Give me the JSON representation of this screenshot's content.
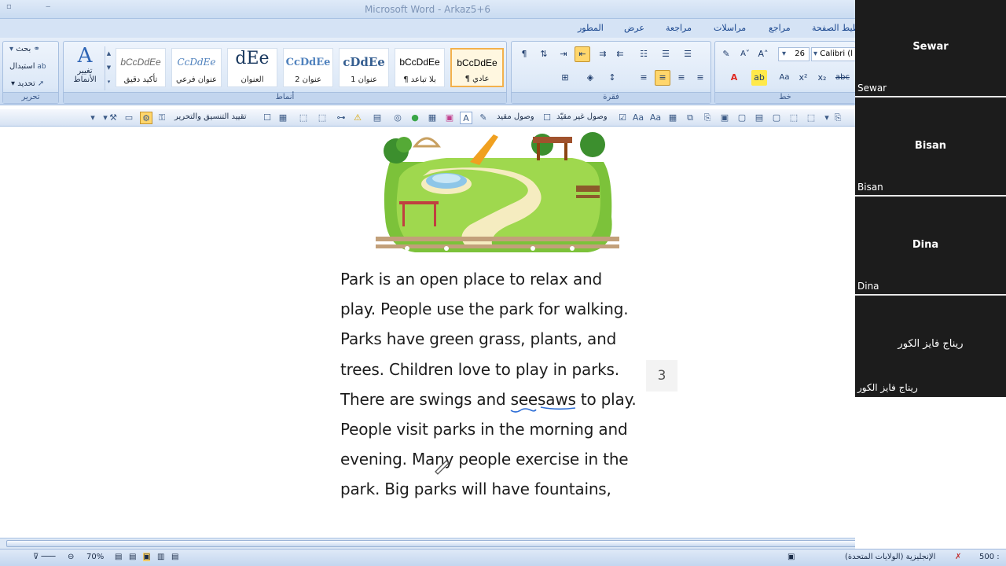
{
  "window": {
    "title": "Microsoft Word - Arkaz5+6"
  },
  "ribbon_tabs": [
    "المطور",
    "عرض",
    "مراجعة",
    "مراسلات",
    "مراجع",
    "تخطيط الصفحة"
  ],
  "editing_group": {
    "label": "تحرير",
    "find": "بحث",
    "replace": "استبدال",
    "select": "تحديد"
  },
  "change_styles": {
    "label_line1": "تغيير",
    "label_line2": "الأنماط"
  },
  "styles_group": {
    "label": "أنماط",
    "styles": [
      {
        "sample": "bCcDdEe",
        "name": "تأكيد دقيق"
      },
      {
        "sample": "CcDdEe",
        "name": "عنوان فرعي"
      },
      {
        "sample": "dEe",
        "name": "العنوان"
      },
      {
        "sample": "CcDdEe",
        "name": "عنوان 2"
      },
      {
        "sample": "cDdEe",
        "name": "عنوان 1"
      },
      {
        "sample": "bCcDdEe",
        "name": "¶ بلا تباعد"
      },
      {
        "sample": "bCcDdEe",
        "name": "¶ عادي"
      }
    ]
  },
  "paragraph_group": {
    "label": "فقرة"
  },
  "font_group": {
    "label": "خط",
    "font_size": "26",
    "font_name": "Calibri (ا"
  },
  "toolbar2": {
    "restrict_formatting": "تقييد التنسيق والتحرير",
    "restricted_access": "وصول مقيد",
    "unrestricted_access": "وصول غير مقيّد"
  },
  "document": {
    "lines": [
      "Park is an open place to relax and",
      "play. People use the park for walking.",
      "Parks have green grass, plants, and",
      "trees. Children love to play in parks.",
      "There are swings and seesaws to play.",
      "People visit parks in the morning and",
      "evening. Many people exercise in the",
      "park. Big parks will have fountains,"
    ],
    "page_number": "3"
  },
  "status_bar": {
    "zoom": "70%",
    "language": "الإنجليزية (الولايات المتحدة)",
    "words": "500 :"
  },
  "participants": [
    {
      "name": "Sewar",
      "label": "Sewar"
    },
    {
      "name": "Bisan",
      "label": "Bisan"
    },
    {
      "name": "Dina ",
      "label": "Dina "
    },
    {
      "name": "ريناج فايز الكور",
      "label": "ريناج فايز الكور"
    }
  ],
  "colors": {
    "ribbon_bg": "#dce8f7",
    "selected_style": "#ffd66c",
    "participants_bg": "#1c1c1c",
    "font_color_red": "#e0261e",
    "highlight_yellow": "#ffe94a"
  }
}
